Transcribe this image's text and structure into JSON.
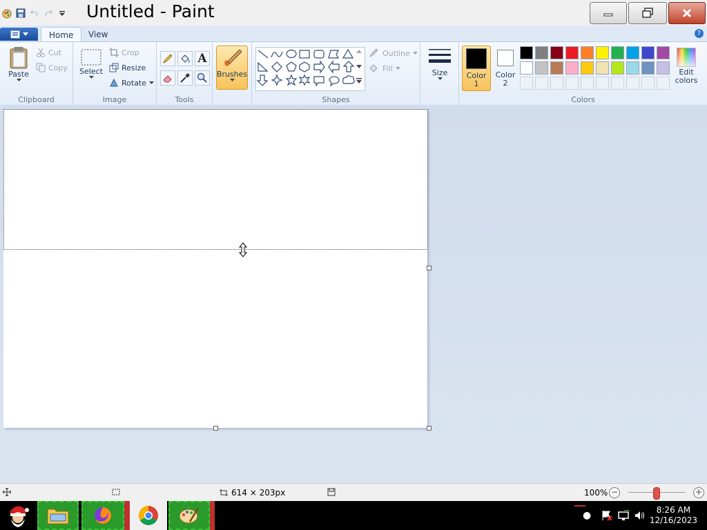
{
  "window": {
    "title": "Untitled - Paint",
    "buttons": {
      "minimize": "minimize",
      "restore": "restore",
      "close": "close"
    }
  },
  "ribbon_tabs": {
    "home": "Home",
    "view": "View"
  },
  "clipboard": {
    "paste": "Paste",
    "cut": "Cut",
    "copy": "Copy",
    "label": "Clipboard"
  },
  "image": {
    "select": "Select",
    "crop": "Crop",
    "resize": "Resize",
    "rotate": "Rotate",
    "label": "Image"
  },
  "tools": {
    "label": "Tools"
  },
  "brushes": {
    "label": "Brushes"
  },
  "shapes": {
    "outline": "Outline",
    "fill": "Fill",
    "label": "Shapes"
  },
  "size": {
    "label": "Size"
  },
  "colors": {
    "color1_label": "Color",
    "color1_num": "1",
    "color2_label": "Color",
    "color2_num": "2",
    "edit_line1": "Edit",
    "edit_line2": "colors",
    "label": "Colors",
    "color1": "#000000",
    "color2": "#ffffff",
    "row1": [
      "#000000",
      "#7f7f7f",
      "#880015",
      "#ed1c24",
      "#ff7f27",
      "#fff200",
      "#22b14c",
      "#00a2e8",
      "#3f48cc",
      "#a349a4"
    ],
    "row2": [
      "#ffffff",
      "#c3c3c3",
      "#b97a57",
      "#ffaec9",
      "#ffc90e",
      "#efe4b0",
      "#b5e61d",
      "#99d9ea",
      "#7092be",
      "#c8bfe7"
    ]
  },
  "status": {
    "selection_size": "614 × 203px",
    "zoom": "100%"
  },
  "taskbar": {
    "time": "8:26 AM",
    "date": "12/16/2023"
  }
}
